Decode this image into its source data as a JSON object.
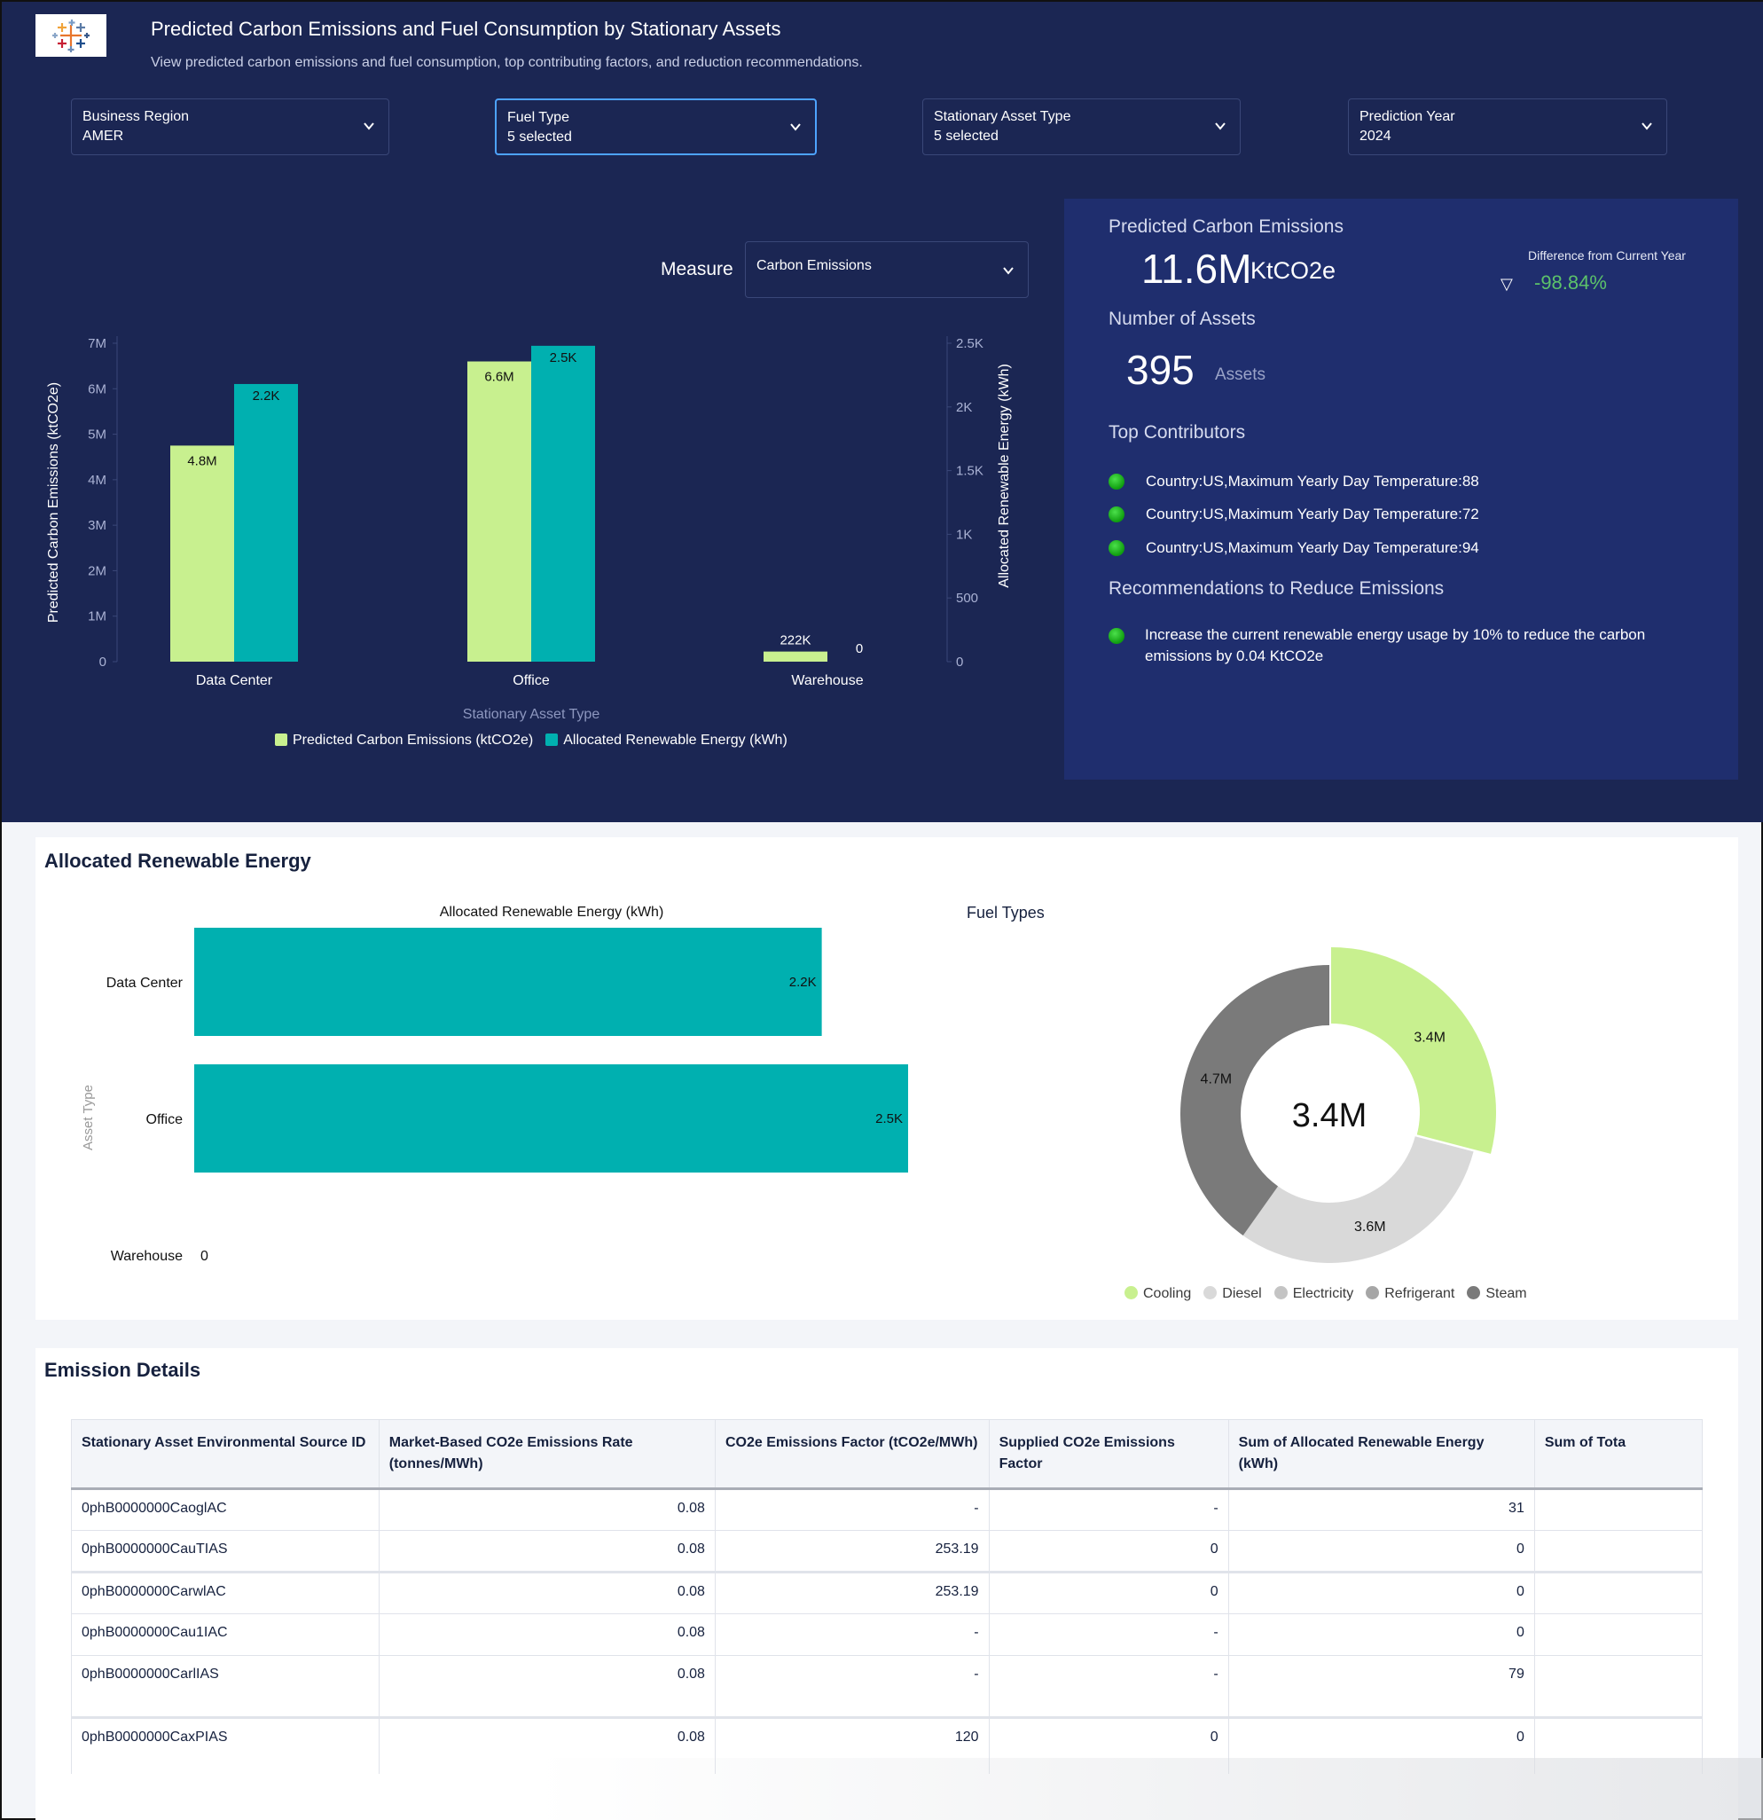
{
  "header": {
    "title": "Predicted Carbon Emissions and Fuel Consumption by Stationary Assets",
    "subtitle": "View predicted carbon emissions and fuel consumption, top contributing factors, and reduction recommendations.",
    "logo": "tableau-logo"
  },
  "filters": [
    {
      "label": "Business Region",
      "value": "AMER"
    },
    {
      "label": "Fuel Type",
      "value": "5 selected"
    },
    {
      "label": "Stationary Asset Type",
      "value": "5 selected"
    },
    {
      "label": "Prediction Year",
      "value": "2024"
    }
  ],
  "measure": {
    "label": "Measure",
    "value": "Carbon Emissions"
  },
  "colors": {
    "emissions": "#c8f08f",
    "renewable": "#00b0b0",
    "navy": "#1b2653",
    "panel": "#1f2e6e",
    "positive_change": "#5cc26a",
    "bullet_green": "#1ec41e"
  },
  "chart_data": [
    {
      "type": "bar",
      "title": "",
      "xlabel": "Stationary Asset Type",
      "ylabel": "Predicted Carbon Emissions (ktCO2e)",
      "y2label": "Allocated Renewable Energy (kWh)",
      "categories": [
        "Data Center",
        "Office",
        "Warehouse"
      ],
      "series": [
        {
          "name": "Predicted Carbon Emissions (ktCO2e)",
          "axis": "left",
          "values": [
            4750000,
            6600000,
            222000
          ],
          "labels": [
            "4.8M",
            "6.6M",
            "222K"
          ]
        },
        {
          "name": "Allocated Renewable Energy (kWh)",
          "axis": "right",
          "values": [
            2180,
            2480,
            0
          ],
          "labels": [
            "2.2K",
            "2.5K",
            "0"
          ]
        }
      ],
      "ylim": [
        0,
        7000000
      ],
      "yticks": [
        "0",
        "1M",
        "2M",
        "3M",
        "4M",
        "5M",
        "6M",
        "7M"
      ],
      "y2lim": [
        0,
        2500
      ],
      "y2ticks": [
        "0",
        "500",
        "1K",
        "1.5K",
        "2K",
        "2.5K"
      ],
      "legend": "bottom"
    },
    {
      "type": "bar",
      "orientation": "horizontal",
      "title": "Allocated Renewable Energy (kWh)",
      "ylabel": "Asset Type",
      "categories": [
        "Data Center",
        "Office",
        "Warehouse"
      ],
      "values": [
        2180,
        2480,
        0
      ],
      "labels": [
        "2.2K",
        "2.5K",
        "0"
      ],
      "xlim": [
        0,
        2480
      ]
    },
    {
      "type": "pie",
      "donut": true,
      "title": "Fuel Types",
      "center_label": "3.4M",
      "slices": [
        {
          "name": "Cooling",
          "value": 3.4,
          "label": "3.4M",
          "color": "#c8f08f",
          "exploded": true
        },
        {
          "name": "Diesel",
          "value": 3.6,
          "label": "3.6M",
          "color": "#d9d9d9"
        },
        {
          "name": "Electricity",
          "value": 0,
          "label": "",
          "color": "#c4c4c4"
        },
        {
          "name": "Refrigerant",
          "value": 0,
          "label": "",
          "color": "#a6a6a6"
        },
        {
          "name": "Steam",
          "value": 4.7,
          "label": "4.7M",
          "color": "#7a7a7a"
        }
      ],
      "legend": "bottom"
    }
  ],
  "summary": {
    "emissions_heading": "Predicted Carbon Emissions",
    "emissions_value": "11.6M",
    "emissions_unit": "KtCO2e",
    "diff_label": "Difference from Current Year",
    "diff_icon": "triangle-down-icon",
    "diff_value": "-98.84%",
    "assets_heading": "Number of Assets",
    "assets_value": "395",
    "assets_unit": "Assets",
    "contributors_heading": "Top Contributors",
    "contributors": [
      "Country:US,Maximum Yearly Day Temperature:88",
      "Country:US,Maximum Yearly Day Temperature:72",
      "Country:US,Maximum Yearly Day Temperature:94"
    ],
    "recommendations_heading": "Recommendations to Reduce Emissions",
    "recommendations": [
      "Increase the current renewable energy usage by 10% to reduce the carbon emissions by 0.04 KtCO2e"
    ]
  },
  "sections": {
    "renewable_title": "Allocated Renewable Energy",
    "details_title": "Emission Details"
  },
  "table": {
    "columns": [
      "Stationary Asset Environmental Source ID",
      "Market-Based CO2e Emissions Rate (tonnes/MWh)",
      "CO2e Emissions Factor (tCO2e/MWh)",
      "Supplied CO2e Emissions Factor",
      "Sum of Allocated Renewable Energy (kWh)",
      "Sum of Tota"
    ],
    "rows": [
      [
        "0phB0000000CaoglAC",
        "0.08",
        "-",
        "-",
        "31",
        ""
      ],
      [
        "0phB0000000CauTIAS",
        "0.08",
        "253.19",
        "0",
        "0",
        ""
      ],
      [
        "0phB0000000CarwlAC",
        "0.08",
        "253.19",
        "0",
        "0",
        ""
      ],
      [
        "0phB0000000Cau1IAC",
        "0.08",
        "-",
        "-",
        "0",
        ""
      ],
      [
        "0phB0000000CarlIAS",
        "0.08",
        "-",
        "-",
        "79",
        ""
      ],
      [
        "0phB0000000CaxPIAS",
        "0.08",
        "120",
        "0",
        "0",
        ""
      ]
    ]
  }
}
